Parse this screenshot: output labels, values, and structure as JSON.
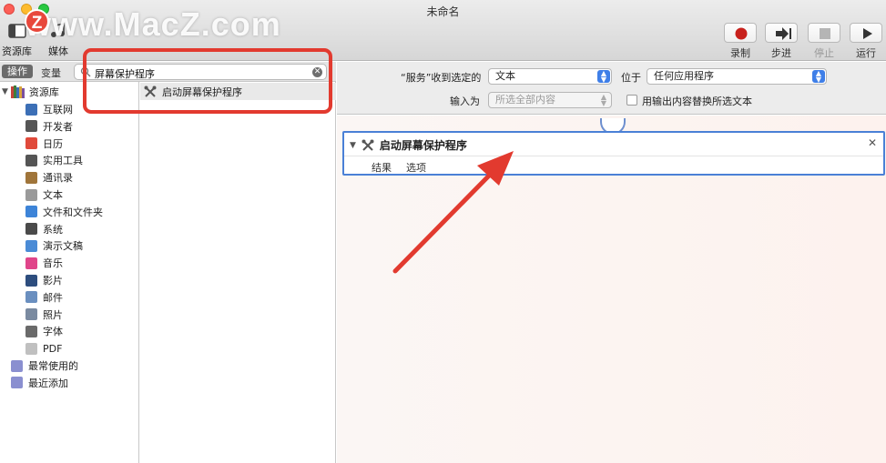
{
  "window": {
    "title": "未命名"
  },
  "watermark": {
    "badge": "Z",
    "text": "www.MacZ.com"
  },
  "toolbar": {
    "library_label": "资源库",
    "media_label": "媒体",
    "record_label": "录制",
    "step_label": "步进",
    "stop_label": "停止",
    "run_label": "运行"
  },
  "sidebar": {
    "tabs": {
      "actions": "操作",
      "variables": "变量"
    },
    "search": {
      "value": "屏幕保护程序"
    },
    "library_root": "资源库",
    "categories": [
      {
        "label": "互联网",
        "icon": "globe-icon",
        "color": "#3c6fb6"
      },
      {
        "label": "开发者",
        "icon": "tools-icon",
        "color": "#555555"
      },
      {
        "label": "日历",
        "icon": "calendar-icon",
        "color": "#e04a3b"
      },
      {
        "label": "实用工具",
        "icon": "utilities-icon",
        "color": "#555555"
      },
      {
        "label": "通讯录",
        "icon": "contacts-icon",
        "color": "#a0753a"
      },
      {
        "label": "文本",
        "icon": "text-icon",
        "color": "#9a9a9a"
      },
      {
        "label": "文件和文件夹",
        "icon": "finder-icon",
        "color": "#3d84d8"
      },
      {
        "label": "系统",
        "icon": "system-icon",
        "color": "#4a4a4a"
      },
      {
        "label": "演示文稿",
        "icon": "presentation-icon",
        "color": "#4a8bd6"
      },
      {
        "label": "音乐",
        "icon": "music-icon",
        "color": "#e0458a"
      },
      {
        "label": "影片",
        "icon": "movie-icon",
        "color": "#2d4d7e"
      },
      {
        "label": "邮件",
        "icon": "mail-icon",
        "color": "#6a8fbf"
      },
      {
        "label": "照片",
        "icon": "photos-icon",
        "color": "#7a8aa0"
      },
      {
        "label": "字体",
        "icon": "font-icon",
        "color": "#6a6a6a"
      },
      {
        "label": "PDF",
        "icon": "pdf-icon",
        "color": "#c0c0c0"
      }
    ],
    "smart_groups": [
      {
        "label": "最常使用的",
        "icon": "smart-folder-icon",
        "color": "#8a8fd0"
      },
      {
        "label": "最近添加",
        "icon": "smart-folder-icon",
        "color": "#8a8fd0"
      }
    ],
    "actions": [
      {
        "label": "启动屏幕保护程序"
      }
    ]
  },
  "workflow_header": {
    "service_receives_label": "“服务”收到选定的",
    "service_receives_value": "文本",
    "in_label": "位于",
    "in_value": "任何应用程序",
    "input_is_label": "输入为",
    "input_is_value": "所选全部内容",
    "replace_label": "用输出内容替换所选文本"
  },
  "workflow": {
    "action_title": "启动屏幕保护程序",
    "tabs": {
      "results": "结果",
      "options": "选项"
    }
  }
}
